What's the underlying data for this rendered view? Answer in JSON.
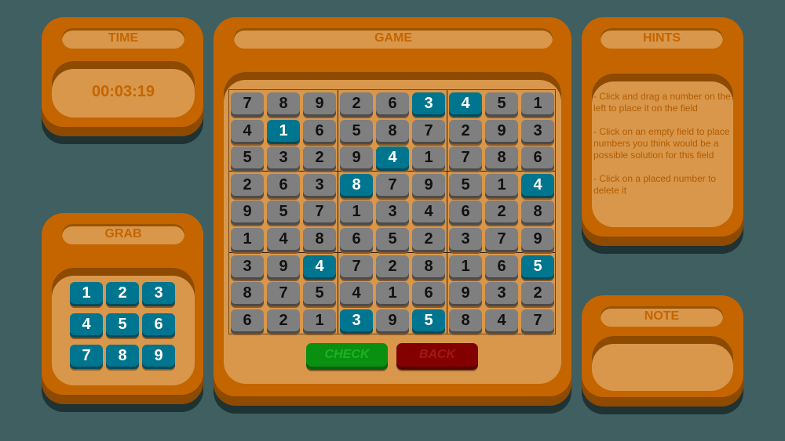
{
  "time": {
    "title": "TIME",
    "value": "00:03:19"
  },
  "grab": {
    "title": "GRAB",
    "numbers": [
      "1",
      "2",
      "3",
      "4",
      "5",
      "6",
      "7",
      "8",
      "9"
    ]
  },
  "game": {
    "title": "GAME",
    "board": [
      [
        7,
        8,
        9,
        2,
        6,
        3,
        4,
        5,
        1
      ],
      [
        4,
        1,
        6,
        5,
        8,
        7,
        2,
        9,
        3
      ],
      [
        5,
        3,
        2,
        9,
        4,
        1,
        7,
        8,
        6
      ],
      [
        2,
        6,
        3,
        8,
        7,
        9,
        5,
        1,
        4
      ],
      [
        9,
        5,
        7,
        1,
        3,
        4,
        6,
        2,
        8
      ],
      [
        1,
        4,
        8,
        6,
        5,
        2,
        3,
        7,
        9
      ],
      [
        3,
        9,
        4,
        7,
        2,
        8,
        1,
        6,
        5
      ],
      [
        8,
        7,
        5,
        4,
        1,
        6,
        9,
        3,
        2
      ],
      [
        6,
        2,
        1,
        3,
        9,
        5,
        8,
        4,
        7
      ]
    ],
    "given": [
      [
        0,
        5
      ],
      [
        0,
        6
      ],
      [
        1,
        1
      ],
      [
        2,
        4
      ],
      [
        3,
        3
      ],
      [
        3,
        8
      ],
      [
        6,
        2
      ],
      [
        6,
        8
      ],
      [
        8,
        3
      ],
      [
        8,
        5
      ]
    ],
    "check_label": "CHECK",
    "back_label": "BACK"
  },
  "hints": {
    "title": "HINTS",
    "items": [
      "- Click and drag a number on the left to place it on the field",
      "- Click on an empty field to place numbers you think would be a possible solution for this field",
      "- Click on a placed number to delete it"
    ]
  },
  "note": {
    "title": "NOTE",
    "content": ""
  },
  "colors": {
    "background": "#3f5f60",
    "panel": "#c46500",
    "panel_inner": "#d9974b",
    "tile": "#7f7f7f",
    "tile_given": "#00758f",
    "check": "#0a9010",
    "back": "#820000"
  }
}
